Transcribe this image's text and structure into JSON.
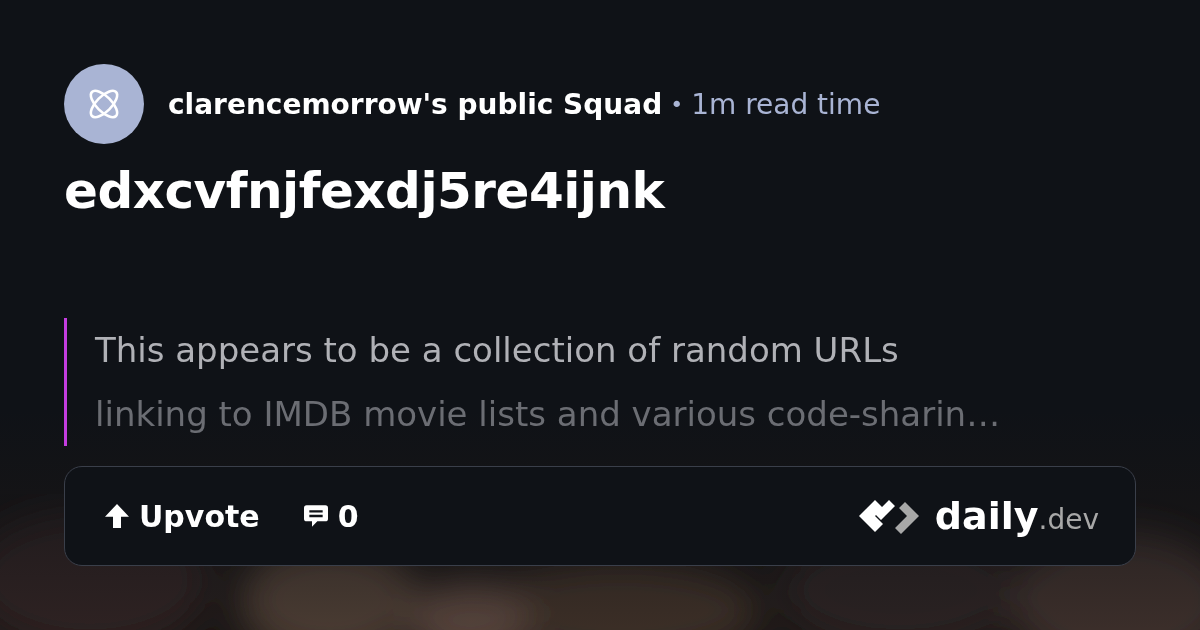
{
  "header": {
    "source": "clarencemorrow's public Squad",
    "separator": "•",
    "read_time": "1m read time"
  },
  "title": "edxcvfnjfexdj5re4ijnk",
  "summary_lines": [
    "This appears to be a collection of random URLs",
    "linking to IMDB movie lists and various code-sharin…"
  ],
  "actions": [
    {
      "kind": "upvote",
      "label": "Upvote"
    },
    {
      "kind": "comments",
      "label": "0"
    }
  ],
  "brand": {
    "name": "daily",
    "suffix": ".dev"
  }
}
